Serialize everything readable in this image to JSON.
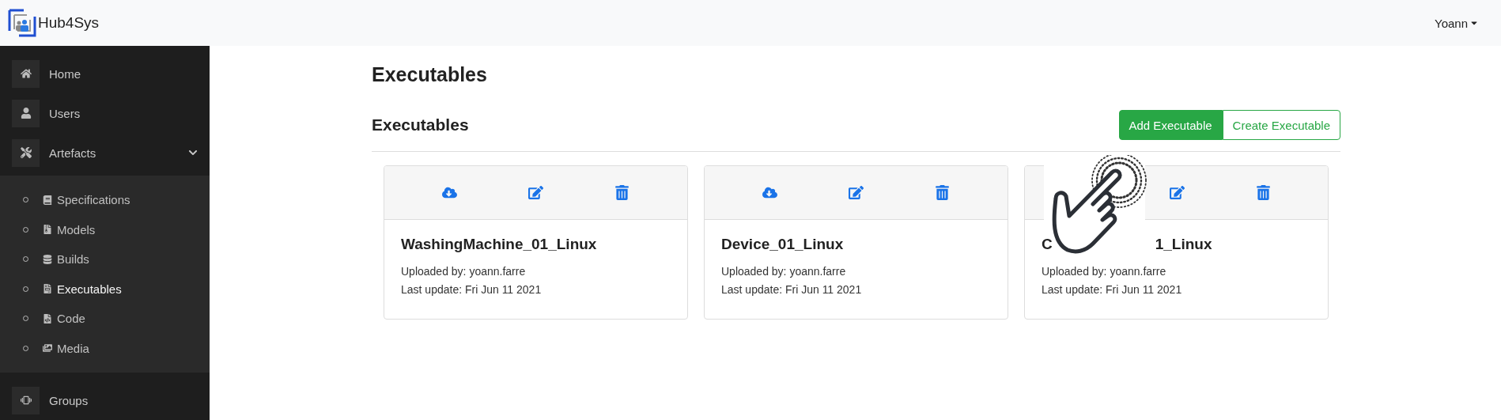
{
  "brand": {
    "name": "Hub4Sys"
  },
  "user_menu": {
    "label": "Yoann"
  },
  "sidebar": {
    "items": [
      {
        "label": "Home",
        "selected": false
      },
      {
        "label": "Users",
        "selected": false
      },
      {
        "label": "Artefacts",
        "selected": false,
        "expanded": true,
        "children": [
          {
            "label": "Specifications",
            "selected": false
          },
          {
            "label": "Models",
            "selected": false
          },
          {
            "label": "Builds",
            "selected": false
          },
          {
            "label": "Executables",
            "selected": true
          },
          {
            "label": "Code",
            "selected": false
          },
          {
            "label": "Media",
            "selected": false
          }
        ]
      },
      {
        "label": "Groups",
        "selected": false
      }
    ]
  },
  "page": {
    "title": "Executables",
    "section_title": "Executables",
    "buttons": [
      {
        "label": "Add Executable",
        "kind": "solid"
      },
      {
        "label": "Create Executable",
        "kind": "outline"
      }
    ]
  },
  "cards": [
    {
      "title_parts": [
        "WashingMachine_01_Linux"
      ],
      "uploaded": "Uploaded by: yoann.farre",
      "updated": "Last update: Fri Jun 11 2021",
      "covered": false
    },
    {
      "title_parts": [
        "Device_01_Linux"
      ],
      "uploaded": "Uploaded by: yoann.farre",
      "updated": "Last update: Fri Jun 11 2021",
      "covered": false
    },
    {
      "title_parts": [
        "C",
        "1_Linux"
      ],
      "uploaded": "Uploaded by: yoann.farre",
      "updated": "Last update: Fri Jun 11 2021",
      "covered": true
    }
  ],
  "overlay": {
    "kind": "tap-gesture"
  }
}
